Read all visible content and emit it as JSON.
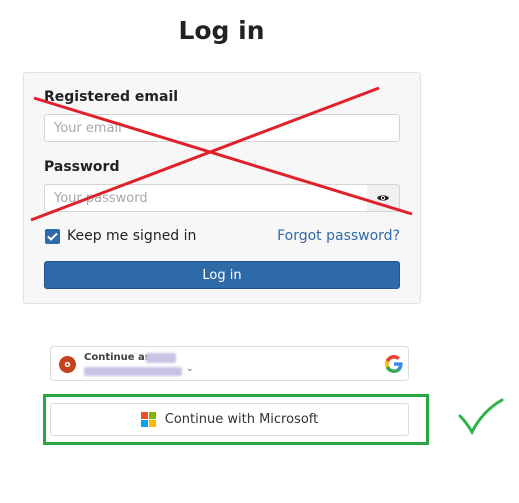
{
  "page": {
    "title": "Log in"
  },
  "login_form": {
    "email_label": "Registered email",
    "email_placeholder": "Your email",
    "password_label": "Password",
    "password_placeholder": "Your password",
    "show_password_icon": "eye-icon",
    "keep_signed_in_label": "Keep me signed in",
    "keep_signed_in_checked": true,
    "forgot_password_label": "Forgot password?",
    "login_button_label": "Log in"
  },
  "google_signin": {
    "continue_as_label": "Continue as",
    "avatar_initial": "o",
    "icon": "google-logo"
  },
  "microsoft_signin": {
    "label": "Continue with Microsoft",
    "icon": "microsoft-logo"
  },
  "annotations": {
    "cross_color": "#e0202a",
    "frame_color": "#27a744",
    "checkmark_color": "#2db34a"
  },
  "colors": {
    "primary": "#2f6aa8",
    "card_background": "#f7f7f7"
  }
}
